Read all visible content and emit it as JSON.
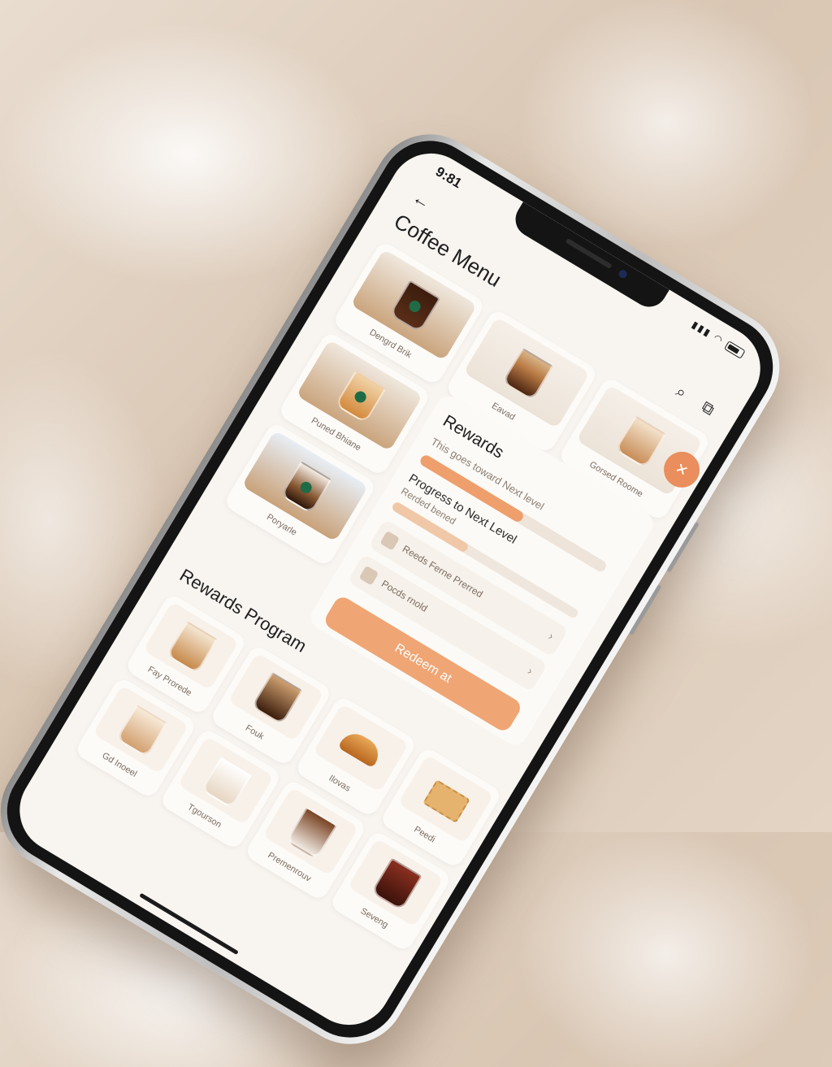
{
  "status_bar": {
    "time": "9:81"
  },
  "header": {
    "title": "Coffee Menu"
  },
  "menu_cards": [
    {
      "label": "Dengrd Brik"
    },
    {
      "label": "Eavad"
    },
    {
      "label": "Gorsed Roome"
    },
    {
      "label": "Puned Bhiane"
    },
    {
      "label": "Poryarle"
    }
  ],
  "rewards": {
    "title": "Rewards",
    "subtitle": "This goes toward Next level",
    "progress_label": "Progress to Next Level",
    "progress_sub": "Rerded bened",
    "progress_1": 0.55,
    "progress_2": 0.4,
    "rows": [
      {
        "text": "Reeds Ferne Prerred"
      },
      {
        "text": "Pocds rnold"
      }
    ],
    "redeem_label": "Redeem at"
  },
  "rewards_program": {
    "title": "Rewards Program",
    "items": [
      {
        "label": "Fay Prorede"
      },
      {
        "label": "Fouk"
      },
      {
        "label": "Ilovas"
      },
      {
        "label": "Peedi"
      },
      {
        "label": "Gd Inoeel"
      },
      {
        "label": "Tgourson"
      },
      {
        "label": "Premenrouv"
      },
      {
        "label": "Seveng"
      }
    ]
  },
  "colors": {
    "accent": "#ee9f6c",
    "background": "#f8f5f1"
  },
  "icons": {
    "back": "back-arrow-icon",
    "search": "search-icon",
    "share": "share-icon",
    "fab": "close-icon"
  }
}
